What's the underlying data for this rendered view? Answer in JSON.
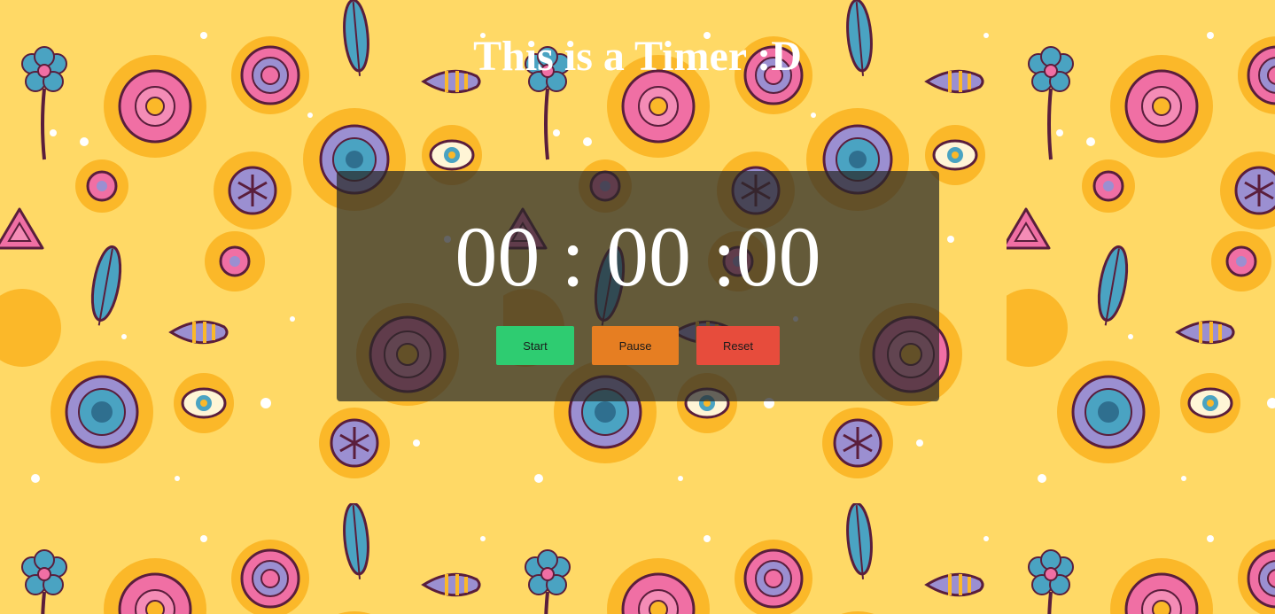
{
  "page": {
    "title": "This is a Timer :D",
    "background_color": "#ffd966"
  },
  "timer": {
    "hours": "00",
    "minutes": "00",
    "seconds": "00",
    "separator": ":"
  },
  "controls": {
    "start_label": "Start",
    "pause_label": "Pause",
    "reset_label": "Reset",
    "start_color": "#2ecc71",
    "pause_color": "#e67e22",
    "reset_color": "#e74c3c"
  },
  "decor": {
    "pattern": "floral-doodle",
    "palette": [
      "#fbb829",
      "#f06fa4",
      "#4aa3c2",
      "#9b8fd1",
      "#5a1e3c"
    ]
  }
}
